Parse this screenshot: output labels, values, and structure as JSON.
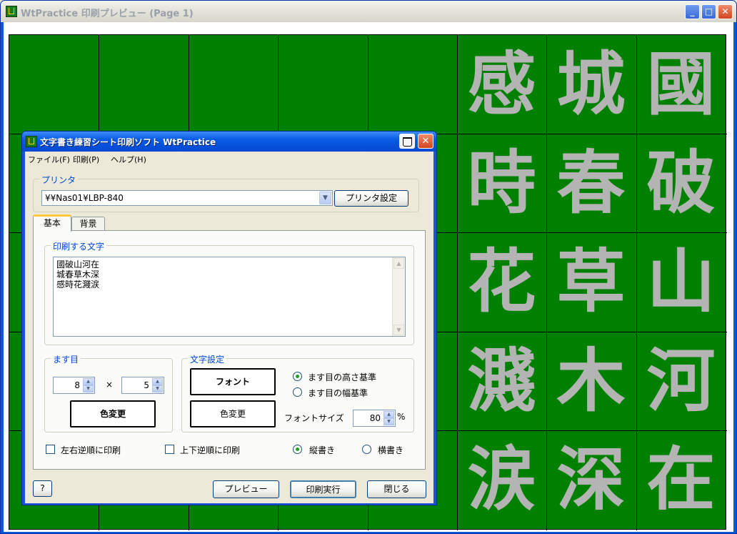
{
  "window": {
    "title": "WtPractice 印刷プレビュー (Page 1)",
    "controls": {
      "minimize": "_",
      "maximize": "□",
      "close": "✕"
    }
  },
  "preview": {
    "columns": [
      [
        "",
        "",
        "",
        "",
        ""
      ],
      [
        "",
        "",
        "",
        "",
        ""
      ],
      [
        "",
        "",
        "",
        "",
        ""
      ],
      [
        "",
        "",
        "",
        "",
        ""
      ],
      [
        "",
        "",
        "",
        "",
        ""
      ],
      [
        "感",
        "時",
        "花",
        "濺",
        "涙"
      ],
      [
        "城",
        "春",
        "草",
        "木",
        "深"
      ],
      [
        "國",
        "破",
        "山",
        "河",
        "在"
      ]
    ],
    "background_color": "#008000",
    "char_color": "#b4b4b4"
  },
  "dialog": {
    "title": "文字書き練習シート印刷ソフト WtPractice",
    "menu": [
      "ファイル(F)",
      "印刷(P)",
      "ヘルプ(H)"
    ],
    "printer": {
      "group_label": "プリンタ",
      "selected": "¥¥Nas01¥LBP-840",
      "settings_button": "プリンタ設定"
    },
    "tabs": [
      "基本",
      "背景"
    ],
    "text_group": {
      "label": "印刷する文字",
      "lines": [
        "國破山河在",
        "城春草木深",
        "感時花濺涙"
      ]
    },
    "grid_group": {
      "label": "ます目",
      "cols_value": "8",
      "times": "×",
      "rows_value": "5",
      "color_button": "色変更"
    },
    "char_group": {
      "label": "文字設定",
      "font_button": "フォント",
      "color_button": "色変更",
      "radio_height": "ます目の高さ基準",
      "radio_width": "ます目の幅基準",
      "font_size_label": "フォントサイズ",
      "font_size_value": "80",
      "percent": "%"
    },
    "options": {
      "mirror_lr": "左右逆順に印刷",
      "mirror_ud": "上下逆順に印刷",
      "vertical": "縦書き",
      "horizontal": "横書き"
    },
    "buttons": {
      "help": "?",
      "preview": "プレビュー",
      "print": "印刷実行",
      "close": "閉じる"
    }
  }
}
